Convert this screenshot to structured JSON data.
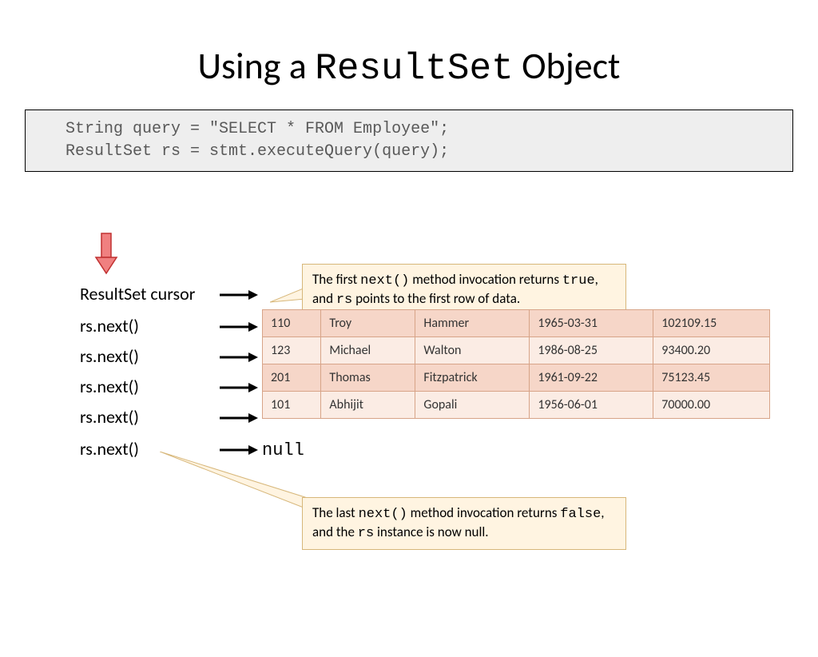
{
  "title": {
    "pre": "Using a ",
    "mono": "ResultSet",
    "post": " Object"
  },
  "code": {
    "line1": "String query = \"SELECT * FROM Employee\";",
    "line2": "ResultSet rs = stmt.executeQuery(query);"
  },
  "cursorLabel": "ResultSet cursor",
  "rsNext": "rs.next()",
  "callout1": {
    "t1": "The first ",
    "m1": "next()",
    "t2": " method invocation returns ",
    "m2": "true",
    "t3": ", and ",
    "m3": "rs",
    "t4": " points to the first row of data."
  },
  "callout2": {
    "t1": "The last ",
    "m1": "next()",
    "t2": " method invocation returns ",
    "m2": "false",
    "t3": ", and the ",
    "m3": "rs",
    "t4": " instance is now null."
  },
  "nullLabel": "null",
  "table": {
    "rows": [
      [
        "110",
        "Troy",
        "Hammer",
        "1965-03-31",
        "102109.15"
      ],
      [
        "123",
        "Michael",
        "Walton",
        "1986-08-25",
        "93400.20"
      ],
      [
        "201",
        "Thomas",
        "Fitzpatrick",
        "1961-09-22",
        "75123.45"
      ],
      [
        "101",
        "Abhijit",
        "Gopali",
        "1956-06-01",
        "70000.00"
      ]
    ]
  }
}
